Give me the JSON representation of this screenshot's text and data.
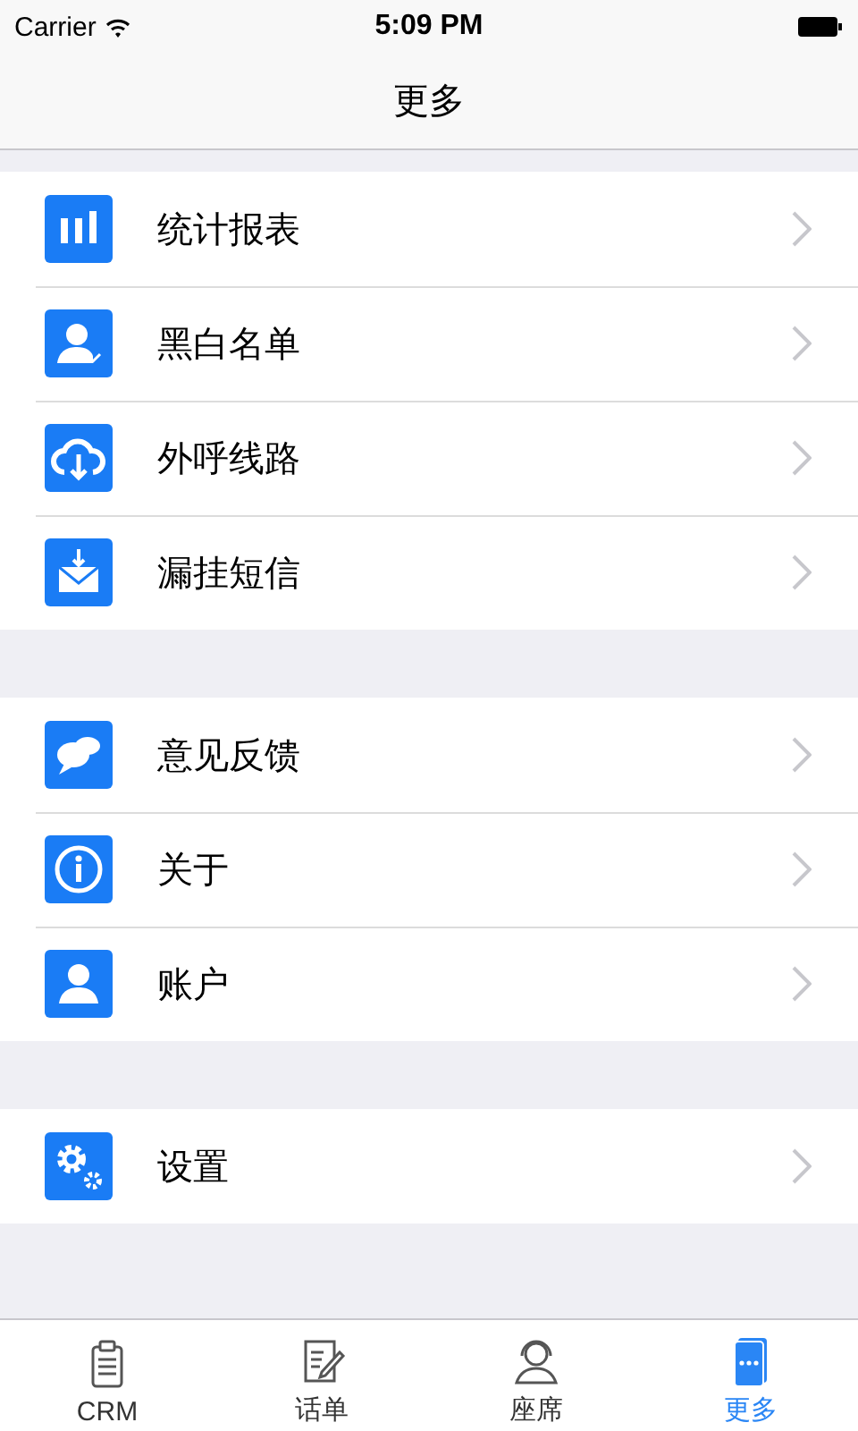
{
  "status_bar": {
    "carrier": "Carrier",
    "time": "5:09 PM"
  },
  "nav_bar": {
    "title": "更多"
  },
  "groups": [
    {
      "items": [
        {
          "label": "统计报表"
        },
        {
          "label": "黑白名单"
        },
        {
          "label": "外呼线路"
        },
        {
          "label": "漏挂短信"
        }
      ]
    },
    {
      "items": [
        {
          "label": "意见反馈"
        },
        {
          "label": "关于"
        },
        {
          "label": "账户"
        }
      ]
    },
    {
      "items": [
        {
          "label": "设置"
        }
      ]
    }
  ],
  "tab_bar": [
    {
      "label": "CRM",
      "selected": false
    },
    {
      "label": "话单",
      "selected": false
    },
    {
      "label": "座席",
      "selected": false
    },
    {
      "label": "更多",
      "selected": true
    }
  ]
}
